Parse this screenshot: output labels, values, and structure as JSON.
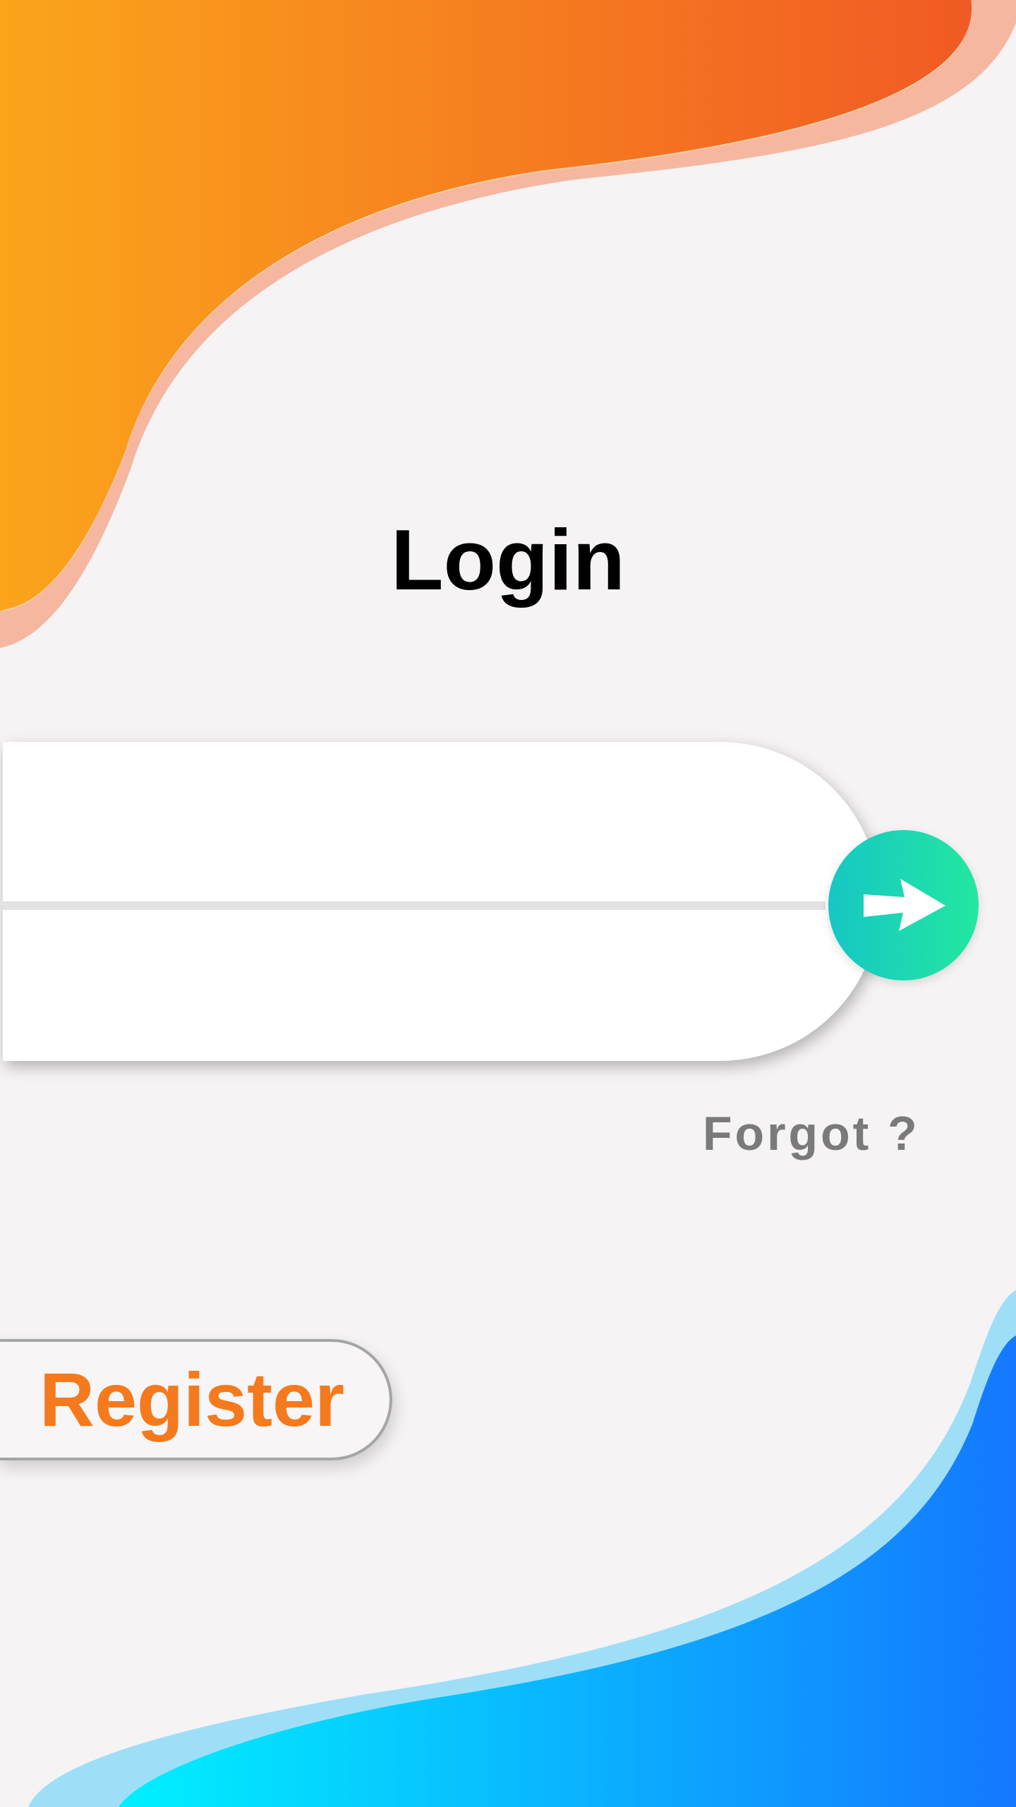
{
  "screen": {
    "title": "Login"
  },
  "login_form": {
    "username_value": "",
    "username_placeholder": "",
    "password_value": "",
    "password_placeholder": "",
    "submit_icon": "arrow-right-icon"
  },
  "links": {
    "forgot": "Forgot ?"
  },
  "register": {
    "label": "Register"
  },
  "colors": {
    "top_wave_start": "#fba51b",
    "top_wave_end": "#f15a24",
    "bottom_wave_start": "#00f0ff",
    "bottom_wave_end": "#1478ff",
    "submit_start": "#16c7c4",
    "submit_end": "#23e7a1",
    "register_text": "#f47a1d",
    "title_text": "#000000",
    "forgot_text": "#7a7a7a"
  }
}
